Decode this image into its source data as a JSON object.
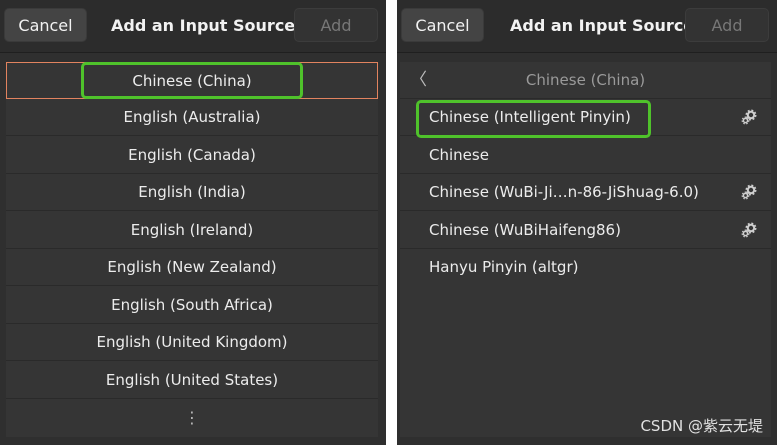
{
  "left_dialog": {
    "cancel_label": "Cancel",
    "title": "Add an Input Source",
    "add_label": "Add",
    "languages": [
      "Chinese (China)",
      "English (Australia)",
      "English (Canada)",
      "English (India)",
      "English (Ireland)",
      "English (New Zealand)",
      "English (South Africa)",
      "English (United Kingdom)",
      "English (United States)"
    ],
    "more_label": "⋮"
  },
  "right_dialog": {
    "cancel_label": "Cancel",
    "title": "Add an Input Source",
    "add_label": "Add",
    "back_chevron": "〈",
    "back_label": "Chinese (China)",
    "sources": [
      {
        "label": "Chinese (Intelligent Pinyin)",
        "has_settings": true
      },
      {
        "label": "Chinese",
        "has_settings": false
      },
      {
        "label": "Chinese (WuBi-Ji…n-86-JiShuag-6.0)",
        "has_settings": true
      },
      {
        "label": "Chinese (WuBiHaifeng86)",
        "has_settings": true
      },
      {
        "label": "Hanyu Pinyin (altgr)",
        "has_settings": false
      }
    ]
  },
  "watermark": "CSDN @紫云无堤",
  "colors": {
    "highlight": "#4fc22b",
    "selection_border": "#e2835f",
    "background": "#2f2f2f"
  }
}
